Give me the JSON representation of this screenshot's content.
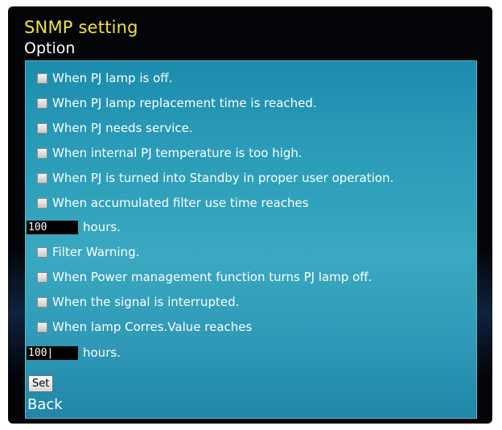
{
  "header": {
    "title": "SNMP setting",
    "subtitle": "Option"
  },
  "options": [
    {
      "label": "When PJ lamp is off.",
      "checked": false
    },
    {
      "label": "When PJ lamp replacement time is reached.",
      "checked": false
    },
    {
      "label": "When PJ needs service.",
      "checked": false
    },
    {
      "label": "When internal PJ temperature is too high.",
      "checked": false
    },
    {
      "label": "When PJ is turned into Standby in proper user operation.",
      "checked": false
    },
    {
      "label": "When accumulated filter use time reaches",
      "checked": false
    }
  ],
  "filter_hours": {
    "value": "100",
    "unit": "hours."
  },
  "options2": [
    {
      "label": "Filter Warning.",
      "checked": false
    },
    {
      "label": "When Power management function turns PJ lamp off.",
      "checked": false
    },
    {
      "label": "When the signal is interrupted.",
      "checked": false
    },
    {
      "label": "When lamp Corres.Value reaches",
      "checked": false
    }
  ],
  "lamp_hours": {
    "value": "100|",
    "unit": "hours."
  },
  "actions": {
    "set_label": "Set",
    "back_label": "Back"
  },
  "colors": {
    "title": "#f2e33a",
    "panel": "#2a9cb8",
    "background": "#020408"
  }
}
